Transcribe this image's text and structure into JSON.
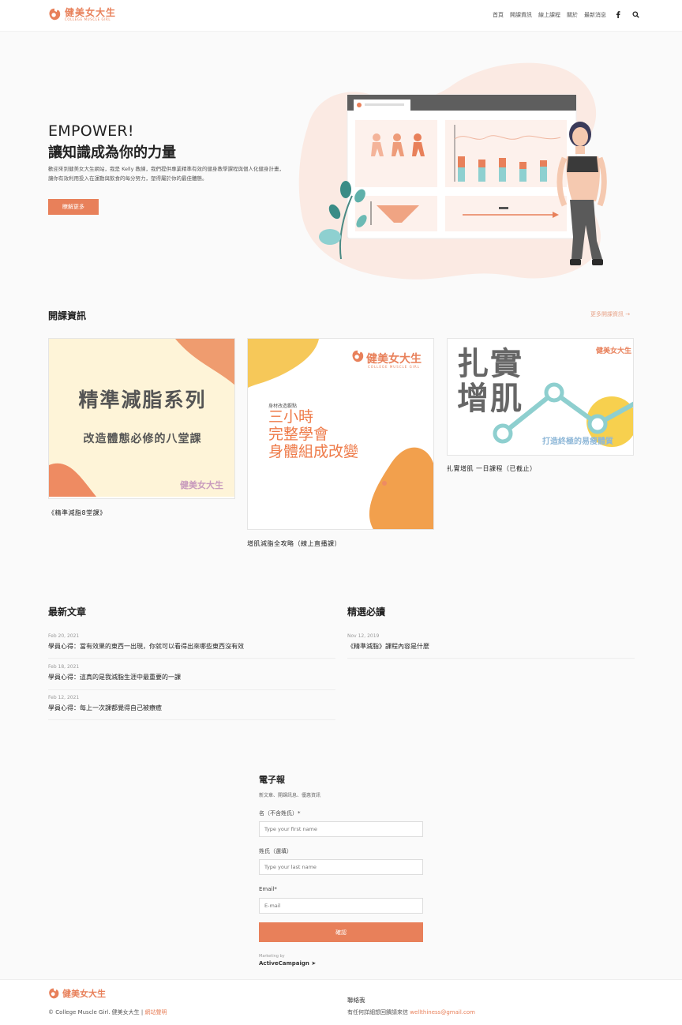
{
  "brand": {
    "name": "健美女大生",
    "tagline": "COLLEGE MUSCLE GIRL",
    "color": "#e8805a"
  },
  "nav": {
    "items": [
      "首頁",
      "開課資訊",
      "線上課程",
      "關於",
      "最新消息"
    ],
    "icons": [
      "facebook-icon",
      "search-icon"
    ]
  },
  "hero": {
    "title": "EMPOWER!",
    "subtitle": "讓知識成為你的力量",
    "description": "歡迎來到健美女大生網站，我是 Kelly 教練，我們提供專業精準有效的健身教學課程與個人化健身計畫，讓你有效利用投入在運動與飲食的每分努力，塑得屬於你的最佳體態。",
    "button": "瞭解更多"
  },
  "courses": {
    "title": "開課資訊",
    "more": "更多開課資訊 →",
    "items": [
      {
        "caption": "《精準減脂8堂課》",
        "headline": "精準減脂系列",
        "subline": "改造體態必修的八堂課",
        "brand": "健美女大生"
      },
      {
        "caption": "增肌減脂全攻略（線上直播課）",
        "kicker": "身材改造觀點",
        "lines": [
          "三小時",
          "完整學會",
          "身體組成改變"
        ],
        "brand": "健美女大生",
        "tagline": "COLLEGE MUSCLE GIRL"
      },
      {
        "caption": "扎實增肌 一日課程（已截止）",
        "headline_top": "扎實",
        "headline_bottom": "增肌",
        "subline": "打造終極的易瘦體質",
        "brand": "健美女大生"
      }
    ]
  },
  "latest": {
    "title": "最新文章",
    "items": [
      {
        "date": "Feb 20, 2021",
        "title": "學員心得：當有效果的東西一出現，你就可以看得出來哪些東西沒有效"
      },
      {
        "date": "Feb 18, 2021",
        "title": "學員心得：這真的是我減脂生涯中最重要的一課"
      },
      {
        "date": "Feb 12, 2021",
        "title": "學員心得：每上一次課都覺得自己被療癒"
      }
    ]
  },
  "featured": {
    "title": "精選必讀",
    "items": [
      {
        "date": "Nov 12, 2019",
        "title": "《精準減脂》課程內容是什麼"
      }
    ]
  },
  "newsletter": {
    "title": "電子報",
    "subtitle": "新文章、開課訊息、優惠資訊",
    "first_label": "名（不含姓氏）*",
    "first_placeholder": "Type your first name",
    "last_label": "姓氏（選填）",
    "last_placeholder": "Type your last name",
    "email_label": "Email*",
    "email_placeholder": "E-mail",
    "submit": "確認",
    "marketing_by": "Marketing by",
    "provider": "ActiveCampaign ➤"
  },
  "footer": {
    "copyright": "© College Muscle Girl. 健美女大生 |",
    "policy": "網站聲明",
    "contact_title": "聯絡我",
    "contact_text": "有任何詳細想回饋請來信",
    "email": "wellthiness@gmail.com"
  }
}
